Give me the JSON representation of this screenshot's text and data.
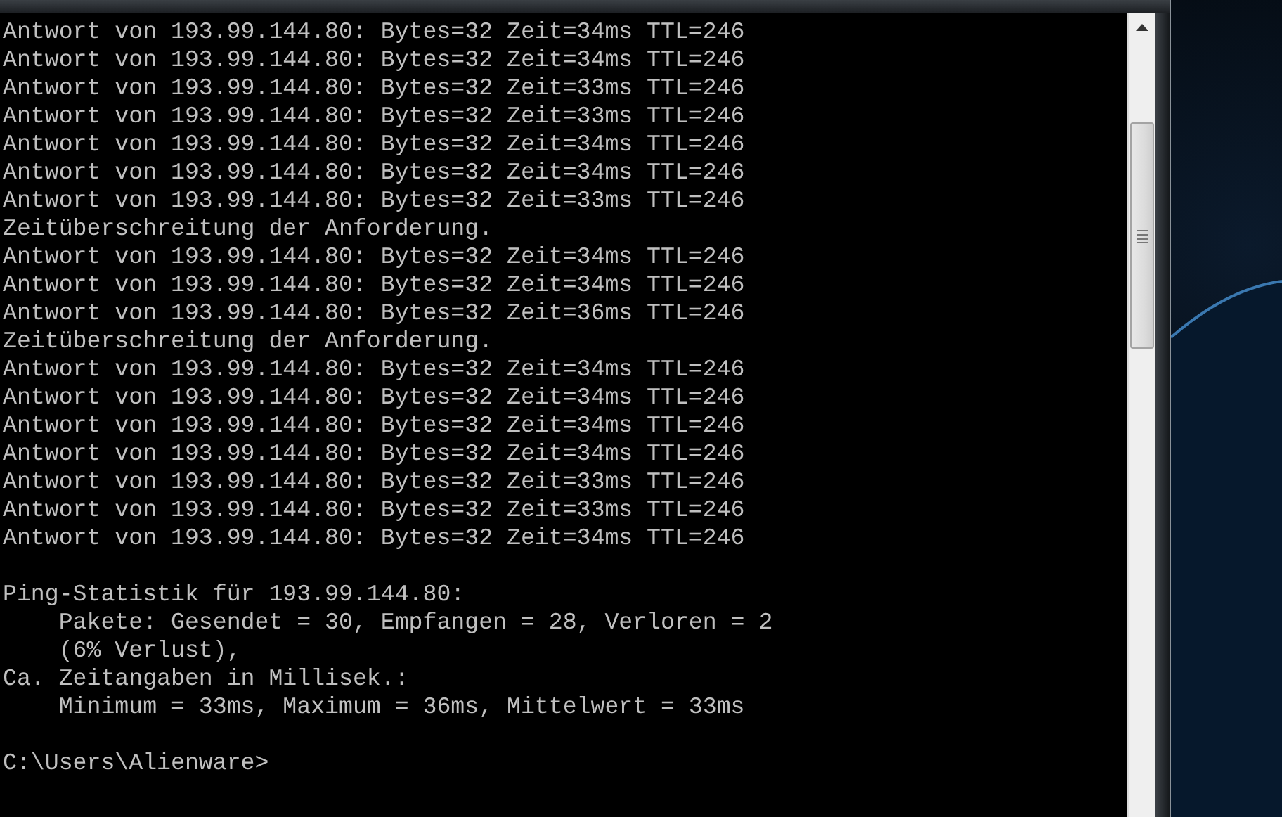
{
  "console": {
    "blocks": [
      {
        "lines": [
          "Antwort von 193.99.144.80: Bytes=32 Zeit=34ms TTL=246",
          "Antwort von 193.99.144.80: Bytes=32 Zeit=34ms TTL=246",
          "Antwort von 193.99.144.80: Bytes=32 Zeit=33ms TTL=246",
          "Antwort von 193.99.144.80: Bytes=32 Zeit=33ms TTL=246",
          "Antwort von 193.99.144.80: Bytes=32 Zeit=34ms TTL=246",
          "Antwort von 193.99.144.80: Bytes=32 Zeit=34ms TTL=246",
          "Antwort von 193.99.144.80: Bytes=32 Zeit=33ms TTL=246",
          "Zeitüberschreitung der Anforderung.",
          "Antwort von 193.99.144.80: Bytes=32 Zeit=34ms TTL=246",
          "Antwort von 193.99.144.80: Bytes=32 Zeit=34ms TTL=246",
          "Antwort von 193.99.144.80: Bytes=32 Zeit=36ms TTL=246",
          "Zeitüberschreitung der Anforderung.",
          "Antwort von 193.99.144.80: Bytes=32 Zeit=34ms TTL=246",
          "Antwort von 193.99.144.80: Bytes=32 Zeit=34ms TTL=246",
          "Antwort von 193.99.144.80: Bytes=32 Zeit=34ms TTL=246",
          "Antwort von 193.99.144.80: Bytes=32 Zeit=34ms TTL=246",
          "Antwort von 193.99.144.80: Bytes=32 Zeit=33ms TTL=246",
          "Antwort von 193.99.144.80: Bytes=32 Zeit=33ms TTL=246",
          "Antwort von 193.99.144.80: Bytes=32 Zeit=34ms TTL=246"
        ]
      },
      {
        "lines": [
          "Ping-Statistik für 193.99.144.80:",
          "    Pakete: Gesendet = 30, Empfangen = 28, Verloren = 2",
          "    (6% Verlust),",
          "Ca. Zeitangaben in Millisek.:",
          "    Minimum = 33ms, Maximum = 36ms, Mittelwert = 33ms"
        ]
      },
      {
        "lines": [
          "C:\\Users\\Alienware>"
        ]
      }
    ]
  }
}
